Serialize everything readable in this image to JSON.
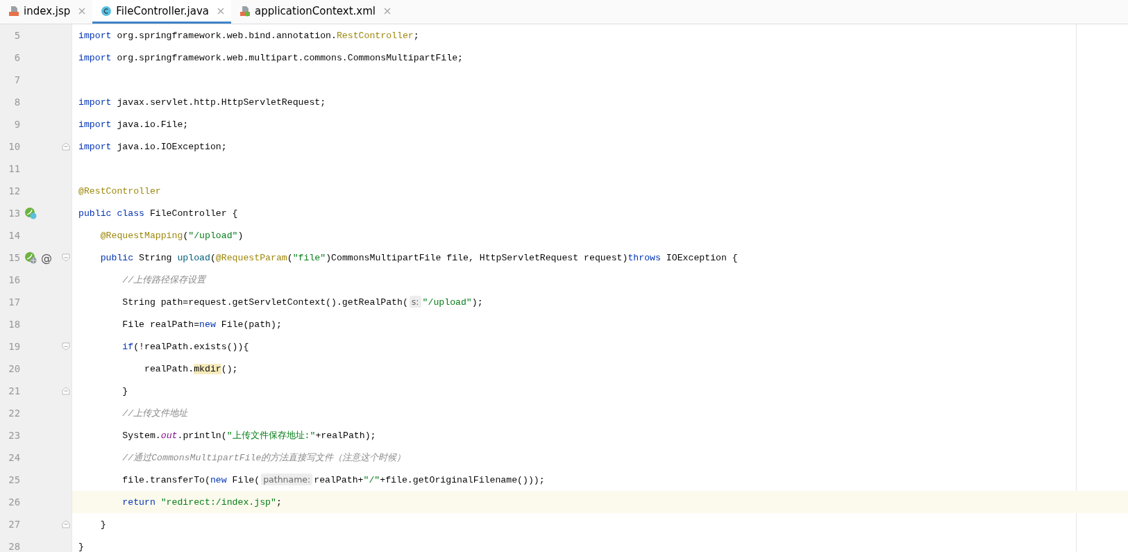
{
  "tabs": [
    {
      "label": "index.jsp",
      "kind": "jsp",
      "selected": false
    },
    {
      "label": "FileController.java",
      "kind": "java",
      "selected": true
    },
    {
      "label": "applicationContext.xml",
      "kind": "xml",
      "selected": false
    }
  ],
  "lines": [
    {
      "number": "5",
      "tokens": [
        {
          "kind": "kw",
          "text": "import"
        },
        {
          "kind": "plain",
          "text": " org.springframework.web.bind.annotation."
        },
        {
          "kind": "ann",
          "text": "RestController"
        },
        {
          "kind": "plain",
          "text": ";"
        }
      ]
    },
    {
      "number": "6",
      "tokens": [
        {
          "kind": "kw",
          "text": "import"
        },
        {
          "kind": "plain",
          "text": " org.springframework.web.multipart.commons.CommonsMultipartFile;"
        }
      ]
    },
    {
      "number": "7"
    },
    {
      "number": "8",
      "tokens": [
        {
          "kind": "kw",
          "text": "import"
        },
        {
          "kind": "plain",
          "text": " javax.servlet.http.HttpServletRequest;"
        }
      ]
    },
    {
      "number": "9",
      "tokens": [
        {
          "kind": "kw",
          "text": "import"
        },
        {
          "kind": "plain",
          "text": " java.io.File;"
        }
      ]
    },
    {
      "number": "10",
      "fold_end": true,
      "tokens": [
        {
          "kind": "kw",
          "text": "import"
        },
        {
          "kind": "plain",
          "text": " java.io.IOException;"
        }
      ]
    },
    {
      "number": "11"
    },
    {
      "number": "12",
      "tokens": [
        {
          "kind": "ann",
          "text": "@RestController"
        }
      ]
    },
    {
      "number": "13",
      "bean": true,
      "tokens": [
        {
          "kind": "kw",
          "text": "public class"
        },
        {
          "kind": "plain",
          "text": " FileController {"
        }
      ]
    },
    {
      "number": "14",
      "tokens": [
        {
          "kind": "ann",
          "text": "    @RequestMapping"
        },
        {
          "kind": "plain",
          "text": "("
        },
        {
          "kind": "str",
          "text": "\"/upload\""
        },
        {
          "kind": "plain",
          "text": ")"
        }
      ]
    },
    {
      "number": "15",
      "bean": true,
      "web": true,
      "at": "@",
      "fold_start": true,
      "tokens": [
        {
          "kind": "kw",
          "text": "    public"
        },
        {
          "kind": "plain",
          "text": " String "
        },
        {
          "kind": "method",
          "text": "upload"
        },
        {
          "kind": "plain",
          "text": "("
        },
        {
          "kind": "ann",
          "text": "@RequestParam"
        },
        {
          "kind": "plain",
          "text": "("
        },
        {
          "kind": "str",
          "text": "\"file\""
        },
        {
          "kind": "plain",
          "text": ")CommonsMultipartFile file, HttpServletRequest request)"
        },
        {
          "kind": "kw",
          "text": "throws"
        },
        {
          "kind": "plain",
          "text": " IOException {"
        }
      ]
    },
    {
      "number": "16",
      "tokens": [
        {
          "kind": "comment",
          "text": "        //上传路径保存设置"
        }
      ]
    },
    {
      "number": "17",
      "tokens": [
        {
          "kind": "plain",
          "text": "        String path=request.getServletContext().getRealPath("
        },
        {
          "kind": "hint",
          "text": "s:"
        },
        {
          "kind": "str",
          "text": "\"/upload\""
        },
        {
          "kind": "plain",
          "text": ");"
        }
      ]
    },
    {
      "number": "18",
      "tokens": [
        {
          "kind": "plain",
          "text": "        File realPath="
        },
        {
          "kind": "kw",
          "text": "new"
        },
        {
          "kind": "plain",
          "text": " File(path);"
        }
      ]
    },
    {
      "number": "19",
      "fold_start": true,
      "tokens": [
        {
          "kind": "kw",
          "text": "        if"
        },
        {
          "kind": "plain",
          "text": "(!realPath.exists()){"
        }
      ]
    },
    {
      "number": "20",
      "tokens": [
        {
          "kind": "plain",
          "text": "            realPath."
        },
        {
          "kind": "mark",
          "text": "mkdir"
        },
        {
          "kind": "plain",
          "text": "();"
        }
      ]
    },
    {
      "number": "21",
      "fold_end": true,
      "tokens": [
        {
          "kind": "plain",
          "text": "        }"
        }
      ]
    },
    {
      "number": "22",
      "tokens": [
        {
          "kind": "comment",
          "text": "        //上传文件地址"
        }
      ]
    },
    {
      "number": "23",
      "tokens": [
        {
          "kind": "plain",
          "text": "        System."
        },
        {
          "kind": "static",
          "text": "out"
        },
        {
          "kind": "plain",
          "text": ".println("
        },
        {
          "kind": "str",
          "text": "\"上传文件保存地址:\""
        },
        {
          "kind": "plain",
          "text": "+realPath);"
        }
      ]
    },
    {
      "number": "24",
      "tokens": [
        {
          "kind": "comment",
          "text": "        //通过CommonsMultipartFile的方法直接写文件（注意这个时候）"
        }
      ]
    },
    {
      "number": "25",
      "tokens": [
        {
          "kind": "plain",
          "text": "        file.transferTo("
        },
        {
          "kind": "kw",
          "text": "new"
        },
        {
          "kind": "plain",
          "text": " File("
        },
        {
          "kind": "hint",
          "text": "pathname:"
        },
        {
          "kind": "plain",
          "text": "realPath+"
        },
        {
          "kind": "str",
          "text": "\"/\""
        },
        {
          "kind": "plain",
          "text": "+file.getOriginalFilename()));"
        }
      ]
    },
    {
      "number": "26",
      "current": true,
      "tokens": [
        {
          "kind": "kw",
          "text": "        return"
        },
        {
          "kind": "str",
          "text": " \"redirect:/index.jsp\""
        },
        {
          "kind": "plain",
          "text": ";"
        }
      ]
    },
    {
      "number": "27",
      "fold_end": true,
      "tokens": [
        {
          "kind": "plain",
          "text": "    }"
        }
      ]
    },
    {
      "number": "28",
      "tokens": [
        {
          "kind": "plain",
          "text": "}"
        }
      ]
    }
  ]
}
